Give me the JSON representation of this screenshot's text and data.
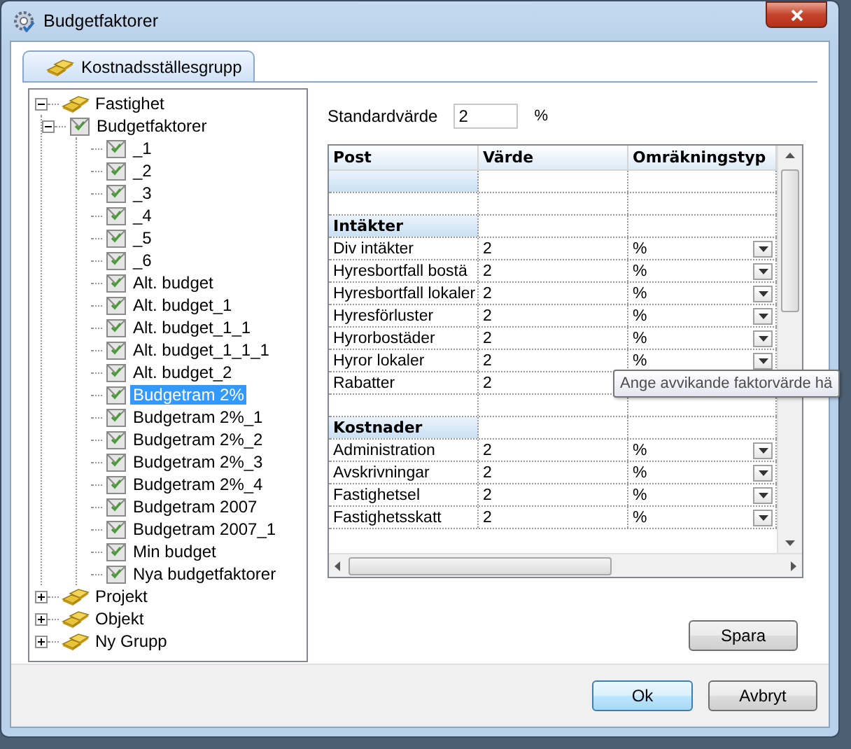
{
  "window": {
    "title": "Budgetfaktorer"
  },
  "tabs": [
    {
      "label": "Kostnadsställesgrupp",
      "selected": true
    }
  ],
  "tree": {
    "items": [
      {
        "label": "Fastighet",
        "kind": "group",
        "expanded": true,
        "selected": false,
        "children": [
          {
            "label": "Budgetfaktorer",
            "kind": "sheet",
            "expanded": true,
            "selected": false,
            "children": [
              {
                "label": "_1",
                "kind": "sheet",
                "selected": false
              },
              {
                "label": "_2",
                "kind": "sheet",
                "selected": false
              },
              {
                "label": "_3",
                "kind": "sheet",
                "selected": false
              },
              {
                "label": "_4",
                "kind": "sheet",
                "selected": false
              },
              {
                "label": "_5",
                "kind": "sheet",
                "selected": false
              },
              {
                "label": "_6",
                "kind": "sheet",
                "selected": false
              },
              {
                "label": "Alt. budget",
                "kind": "sheet",
                "selected": false
              },
              {
                "label": "Alt. budget_1",
                "kind": "sheet",
                "selected": false
              },
              {
                "label": "Alt. budget_1_1",
                "kind": "sheet",
                "selected": false
              },
              {
                "label": "Alt. budget_1_1_1",
                "kind": "sheet",
                "selected": false
              },
              {
                "label": "Alt. budget_2",
                "kind": "sheet",
                "selected": false
              },
              {
                "label": "Budgetram 2%",
                "kind": "sheet",
                "selected": true
              },
              {
                "label": "Budgetram 2%_1",
                "kind": "sheet",
                "selected": false
              },
              {
                "label": "Budgetram 2%_2",
                "kind": "sheet",
                "selected": false
              },
              {
                "label": "Budgetram 2%_3",
                "kind": "sheet",
                "selected": false
              },
              {
                "label": "Budgetram 2%_4",
                "kind": "sheet",
                "selected": false
              },
              {
                "label": "Budgetram 2007",
                "kind": "sheet",
                "selected": false
              },
              {
                "label": "Budgetram 2007_1",
                "kind": "sheet",
                "selected": false
              },
              {
                "label": "Min budget",
                "kind": "sheet",
                "selected": false
              },
              {
                "label": "Nya budgetfaktorer",
                "kind": "sheet",
                "selected": false
              }
            ]
          }
        ]
      },
      {
        "label": "Projekt",
        "kind": "group",
        "expanded": false,
        "selected": false
      },
      {
        "label": "Objekt",
        "kind": "group",
        "expanded": false,
        "selected": false
      },
      {
        "label": "Ny Grupp",
        "kind": "group",
        "expanded": false,
        "selected": false
      }
    ]
  },
  "standard": {
    "label": "Standardvärde",
    "value": "2",
    "unit": "%"
  },
  "table": {
    "columns": [
      "Post",
      "Värde",
      "Omräkningstyp"
    ],
    "rows": [
      {
        "kind": "group"
      },
      {
        "kind": "blank"
      },
      {
        "kind": "group",
        "post": "Intäkter"
      },
      {
        "kind": "item",
        "post": "Div intäkter",
        "value": "2",
        "type": "%"
      },
      {
        "kind": "item",
        "post": "Hyresbortfall bostä",
        "value": "2",
        "type": "%"
      },
      {
        "kind": "item",
        "post": "Hyresbortfall lokaler",
        "value": "2",
        "type": "%"
      },
      {
        "kind": "item",
        "post": "Hyresförluster",
        "value": "2",
        "type": "%"
      },
      {
        "kind": "item",
        "post": "Hyrorbostäder",
        "value": "2",
        "type": "%"
      },
      {
        "kind": "item",
        "post": "Hyror lokaler",
        "value": "2",
        "type": "%"
      },
      {
        "kind": "item",
        "post": "Rabatter",
        "value": "2"
      },
      {
        "kind": "blank"
      },
      {
        "kind": "group",
        "post": "Kostnader"
      },
      {
        "kind": "item",
        "post": "Administration",
        "value": "2",
        "type": "%"
      },
      {
        "kind": "item",
        "post": "Avskrivningar",
        "value": "2",
        "type": "%"
      },
      {
        "kind": "item",
        "post": "Fastighetsel",
        "value": "2",
        "type": "%"
      },
      {
        "kind": "item",
        "post": "Fastighetsskatt",
        "value": "2",
        "type": "%"
      }
    ]
  },
  "tooltip": "Ange avvikande faktorvärde hä",
  "buttons": {
    "save": "Spara",
    "ok": "Ok",
    "cancel": "Avbryt"
  }
}
